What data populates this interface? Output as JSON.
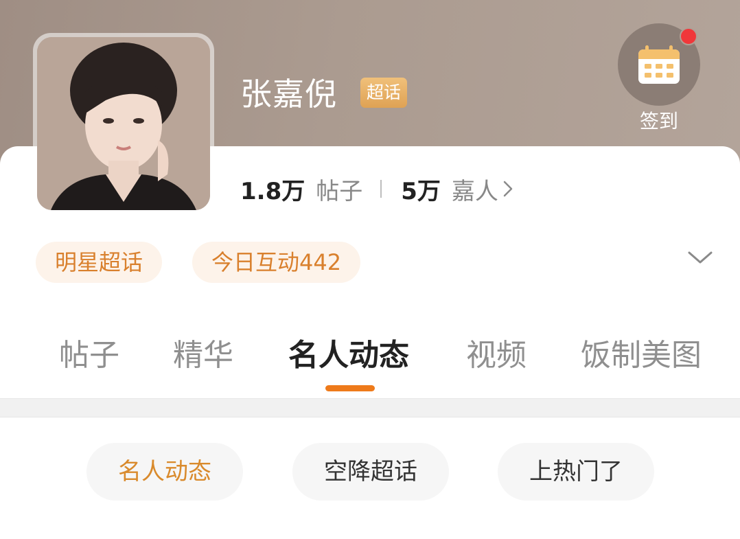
{
  "profile": {
    "name": "张嘉倪",
    "badge": "超话",
    "posts_count": "1.8万",
    "posts_label": "帖子",
    "fans_count": "5万",
    "fans_label": "嘉人"
  },
  "checkin": {
    "label": "签到",
    "has_notification": true
  },
  "tags": [
    "明星超话",
    "今日互动442"
  ],
  "tabs": [
    "帖子",
    "精华",
    "名人动态",
    "视频",
    "饭制美图"
  ],
  "active_tab": "名人动态",
  "filters": [
    "名人动态",
    "空降超话",
    "上热门了"
  ],
  "active_filter": "名人动态",
  "colors": {
    "accent": "#ee7a1a",
    "tag_text": "#d9802d",
    "tag_bg": "#fdf3ea",
    "badge": "#e8b15f",
    "notification": "#f0373a"
  }
}
